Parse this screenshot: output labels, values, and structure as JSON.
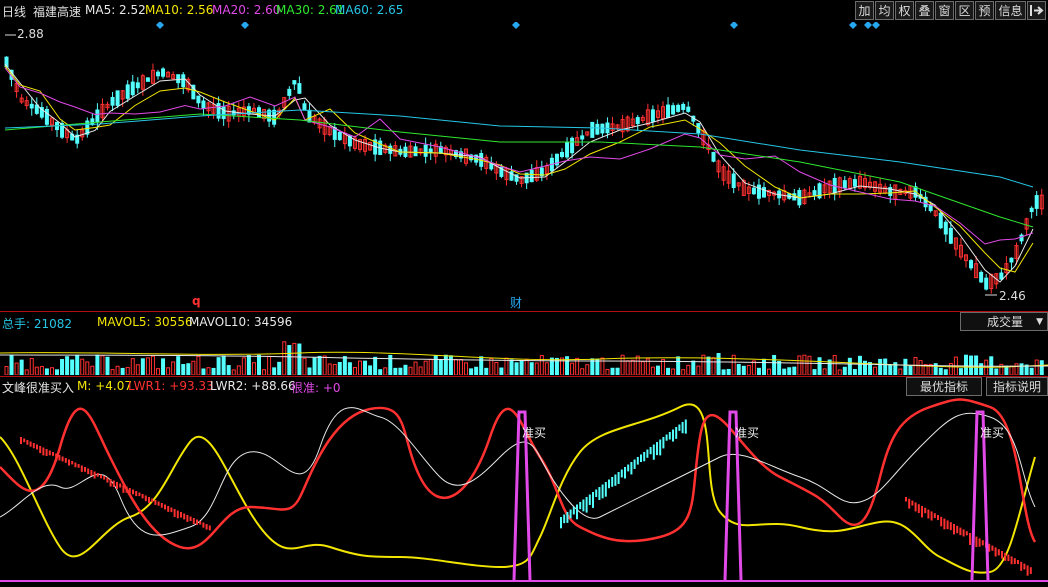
{
  "header": {
    "period": "日线",
    "stock_name": "福建高速",
    "ma": [
      {
        "label": "MA5: 2.52",
        "color": "#e8e8e8"
      },
      {
        "label": "MA10: 2.56",
        "color": "#f2e600"
      },
      {
        "label": "MA20: 2.60",
        "color": "#e14ae8"
      },
      {
        "label": "MA30: 2.61",
        "color": "#2ee82e"
      },
      {
        "label": "MA60: 2.65",
        "color": "#26c6e6"
      }
    ],
    "buttons": [
      "加",
      "均",
      "权",
      "叠",
      "窗",
      "区",
      "预",
      "信息"
    ],
    "exit_icon": "exit-icon"
  },
  "price_panel": {
    "high_label": "2.88",
    "low_label": "2.46",
    "markers": {
      "q": "q",
      "cai": "财"
    }
  },
  "volume_panel": {
    "items": [
      {
        "label": "总手: 21082",
        "color": "#26c6e6"
      },
      {
        "label": "MAVOL5: 30556",
        "color": "#f2e600"
      },
      {
        "label": "MAVOL10: 34596",
        "color": "#e8e8e8"
      }
    ],
    "selector": "成交量",
    "selector_icon": "chevron-down-icon"
  },
  "indicator_panel": {
    "items": [
      {
        "label": "文峰很准买入",
        "color": "#e8e8e8"
      },
      {
        "label": "M: +4.07",
        "color": "#f2e600"
      },
      {
        "label": "LWR1: +93.33",
        "color": "#ff3030"
      },
      {
        "label": "LWR2: +88.66",
        "color": "#e8e8e8"
      },
      {
        "label": "很准: +0",
        "color": "#e14ae8"
      }
    ],
    "buttons": [
      "最优指标",
      "指标说明"
    ],
    "signals": [
      "准买",
      "准买",
      "准买"
    ]
  },
  "colors": {
    "up": "#ff3030",
    "down": "#54ffff",
    "divider": "#b01010",
    "ma5": "#e8e8e8",
    "ma10": "#f2e600",
    "ma20": "#e14ae8",
    "ma30": "#2ee82e",
    "ma60": "#26c6e6",
    "signal": "#e14ae8",
    "marker": "#26a7f0"
  }
}
